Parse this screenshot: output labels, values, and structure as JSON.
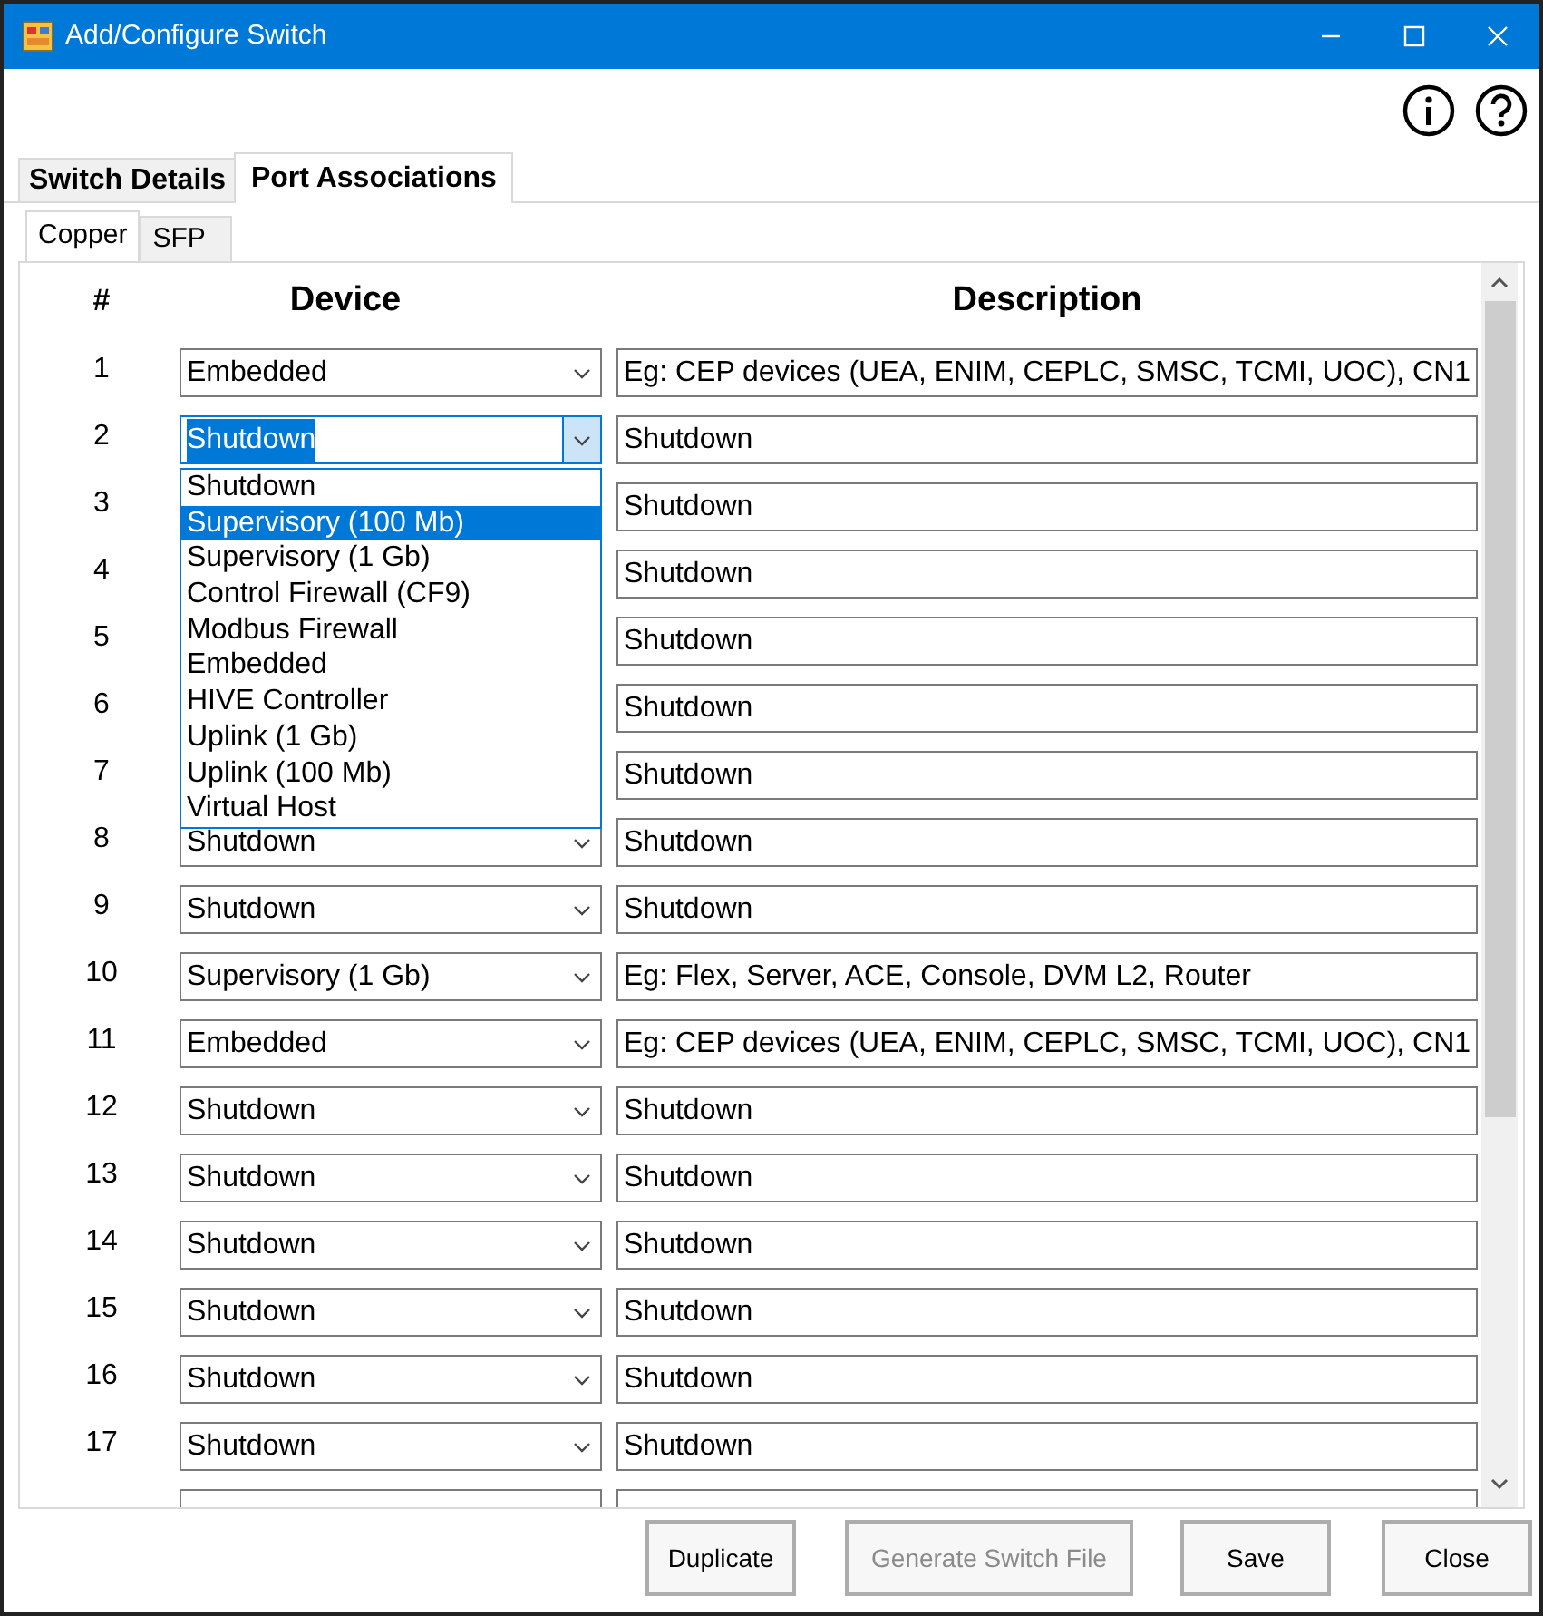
{
  "window": {
    "title": "Add/Configure Switch"
  },
  "tabs": [
    {
      "label": "Switch Details",
      "selected": false
    },
    {
      "label": "Port Associations",
      "selected": true
    }
  ],
  "subtabs": [
    {
      "label": "Copper",
      "selected": true
    },
    {
      "label": "SFP",
      "selected": false
    }
  ],
  "columns": [
    "#",
    "Device",
    "Description"
  ],
  "rows": [
    {
      "number": "1",
      "device": "Embedded",
      "description": "Eg: CEP devices (UEA, ENIM, CEPLC, SMSC, TCMI, UOC), CN1"
    },
    {
      "number": "2",
      "device": "Shutdown",
      "description": "Shutdown",
      "dropdown": {
        "options": [
          {
            "label": "Shutdown",
            "selected": false
          },
          {
            "label": "Supervisory (100 Mb)",
            "selected": true
          },
          {
            "label": "Supervisory (1 Gb)",
            "selected": false
          },
          {
            "label": "Control Firewall (CF9)",
            "selected": false
          },
          {
            "label": "Modbus Firewall",
            "selected": false
          },
          {
            "label": "Embedded",
            "selected": false
          },
          {
            "label": "HIVE Controller",
            "selected": false
          },
          {
            "label": "Uplink (1 Gb)",
            "selected": false
          },
          {
            "label": "Uplink (100 Mb)",
            "selected": false
          },
          {
            "label": "Virtual Host",
            "selected": false
          }
        ]
      }
    },
    {
      "number": "3",
      "description": "Shutdown"
    },
    {
      "number": "4",
      "description": "Shutdown"
    },
    {
      "number": "5",
      "description": "Shutdown"
    },
    {
      "number": "6",
      "description": "Shutdown"
    },
    {
      "number": "7",
      "description": "Shutdown"
    },
    {
      "number": "8",
      "device": "Shutdown",
      "description": "Shutdown"
    },
    {
      "number": "9",
      "device": "Shutdown",
      "description": "Shutdown"
    },
    {
      "number": "10",
      "device": "Supervisory (1 Gb)",
      "description": "Eg: Flex, Server, ACE, Console, DVM L2, Router"
    },
    {
      "number": "11",
      "device": "Embedded",
      "description": "Eg: CEP devices (UEA, ENIM, CEPLC, SMSC, TCMI, UOC), CN1"
    },
    {
      "number": "12",
      "device": "Shutdown",
      "description": "Shutdown"
    },
    {
      "number": "13",
      "device": "Shutdown",
      "description": "Shutdown"
    },
    {
      "number": "14",
      "device": "Shutdown",
      "description": "Shutdown"
    },
    {
      "number": "15",
      "device": "Shutdown",
      "description": "Shutdown"
    },
    {
      "number": "16",
      "device": "Shutdown",
      "description": "Shutdown"
    },
    {
      "number": "17",
      "device": "Shutdown",
      "description": "Shutdown"
    }
  ],
  "buttons": [
    {
      "label": "Duplicate",
      "disabled": false
    },
    {
      "label": "Generate Switch File",
      "disabled": true
    },
    {
      "label": "Save",
      "disabled": false
    },
    {
      "label": "Close",
      "disabled": false
    }
  ]
}
